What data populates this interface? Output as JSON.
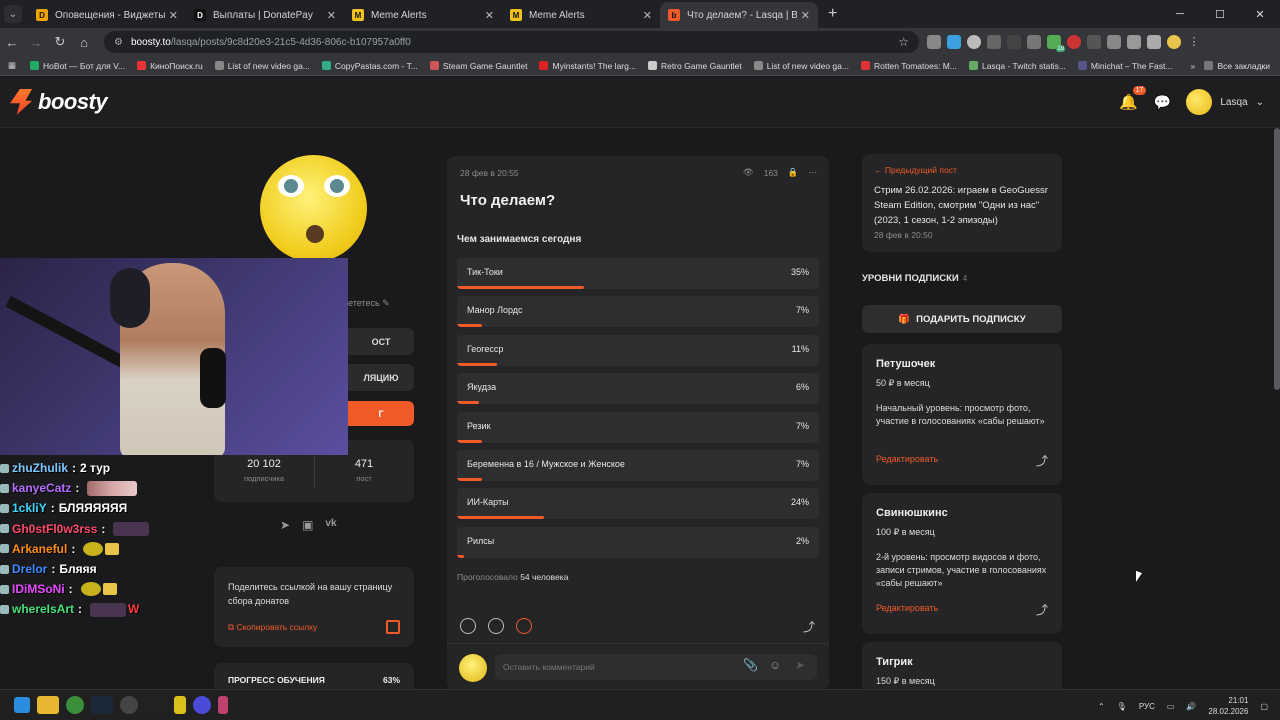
{
  "browser": {
    "tabs": [
      {
        "label": "Оповещения - Виджеты - Don",
        "color": "#f0a400",
        "glyph": "D"
      },
      {
        "label": "Выплаты | DonatePay",
        "color": "#111",
        "glyph": "D"
      },
      {
        "label": "Meme Alerts",
        "color": "#f3c21b",
        "glyph": "M"
      },
      {
        "label": "Meme Alerts",
        "color": "#f3c21b",
        "glyph": "M"
      },
      {
        "label": "Что делаем? - Lasqa | Boosty",
        "color": "#f05a28",
        "glyph": "b"
      }
    ],
    "url_host": "boosty.to",
    "url_path": "/lasqa/posts/9c8d20e3-21c5-4d36-806c-b107957a0ff0",
    "bookmarks": [
      "HoBot — Бот для V...",
      "КиноПоиск.ru",
      "List of new video ga...",
      "CopyPastas.com - T...",
      "Steam Game Gauntlet",
      "Myinstants! The larg...",
      "Retro Game Gauntlet",
      "List of new video ga...",
      "Rotten Tomatoes: M...",
      "Lasqa - Twitch statis...",
      "Minichat – The Fast..."
    ],
    "all_bookmarks": "Все закладки",
    "ext_badge": "19"
  },
  "header": {
    "logo": "boosty",
    "notifications": "17",
    "username": "Lasqa"
  },
  "profile": {
    "sub_edit": "ететесь",
    "btn_post": "ОСТ",
    "btn_collection": "ЛЯЦИЮ",
    "btn_orange": "Г",
    "subscribers": "20 102",
    "subscribers_label": "подписчика",
    "posts": "471",
    "posts_label": "пост",
    "share_text": "Поделитесь ссылкой на вашу страницу сбора донатов",
    "copy_link": "Скопировать ссылку",
    "progress_title": "ПРОГРЕСС ОБУЧЕНИЯ",
    "progress_value": "63%"
  },
  "stream_chat": [
    {
      "user": "zhuZhulik",
      "color": "#7ec8ff",
      "msg": "2 тур",
      "emote": ""
    },
    {
      "user": "kanyeCatz",
      "color": "#b46cff",
      "msg": "",
      "emote": "wide"
    },
    {
      "user": "1ckliY",
      "color": "#3ad8ff",
      "msg": "БЛЯЯЯЯЯЯ",
      "emote": ""
    },
    {
      "user": "Gh0stFl0w3rss",
      "color": "#ff4a6a",
      "msg": "",
      "emote": "m"
    },
    {
      "user": "Arkaneful",
      "color": "#ff8c1a",
      "msg": "",
      "emote": "s"
    },
    {
      "user": "Drelor",
      "color": "#3a8cff",
      "msg": "Бляяя",
      "emote": ""
    },
    {
      "user": "IDiMSoNi",
      "color": "#e64bff",
      "msg": "",
      "emote": "s"
    },
    {
      "user": "whereIsArt",
      "color": "#49e07a",
      "msg": "W",
      "emote": "m"
    }
  ],
  "post": {
    "date": "28 фев в 20:55",
    "views": "163",
    "title": "Что делаем?",
    "question": "Чем занимаемся сегодня",
    "options": [
      {
        "label": "Тик-Токи",
        "percent": 35
      },
      {
        "label": "Манор Лордс",
        "percent": 7
      },
      {
        "label": "Геогесср",
        "percent": 11
      },
      {
        "label": "Якудза",
        "percent": 6
      },
      {
        "label": "Резик",
        "percent": 7
      },
      {
        "label": "Беременна в 16 / Мужское и Женское",
        "percent": 7
      },
      {
        "label": "ИИ-Карты",
        "percent": 24
      },
      {
        "label": "Рилсы",
        "percent": 2
      }
    ],
    "voted_prefix": "Проголосовало",
    "voted_count": "54 человека",
    "comment_placeholder": "Оставить комментарий"
  },
  "sidebar": {
    "prev_label": "Предыдущий пост",
    "prev_title": "Стрим 26.02.2026: играем в GeoGuessr Steam Edition, смотрим \"Одни из нас\" (2023, 1 сезон, 1-2 эпизоды)",
    "prev_date": "28 фев в 20:50",
    "tiers_heading": "УРОВНИ ПОДПИСКИ",
    "tiers_count": "4",
    "gift_button": "ПОДАРИТЬ ПОДПИСКУ",
    "tiers": [
      {
        "name": "Петушочек",
        "price": "50 ₽ в месяц",
        "desc": "Начальный уровень: просмотр фото, участие в голосованиях «сабы решают»",
        "edit": "Редактировать"
      },
      {
        "name": "Свинюшкинс",
        "price": "100 ₽ в месяц",
        "desc": "2-й уровень: просмотр видосов и фото, записи стримов, участие в голосованиях «сабы решают»",
        "edit": "Редактировать"
      },
      {
        "name": "Тигрик",
        "price": "150 ₽ в месяц",
        "desc": "",
        "edit": ""
      }
    ]
  },
  "taskbar": {
    "lang": "РУС",
    "time": "21:01",
    "date": "28.02.2026"
  }
}
